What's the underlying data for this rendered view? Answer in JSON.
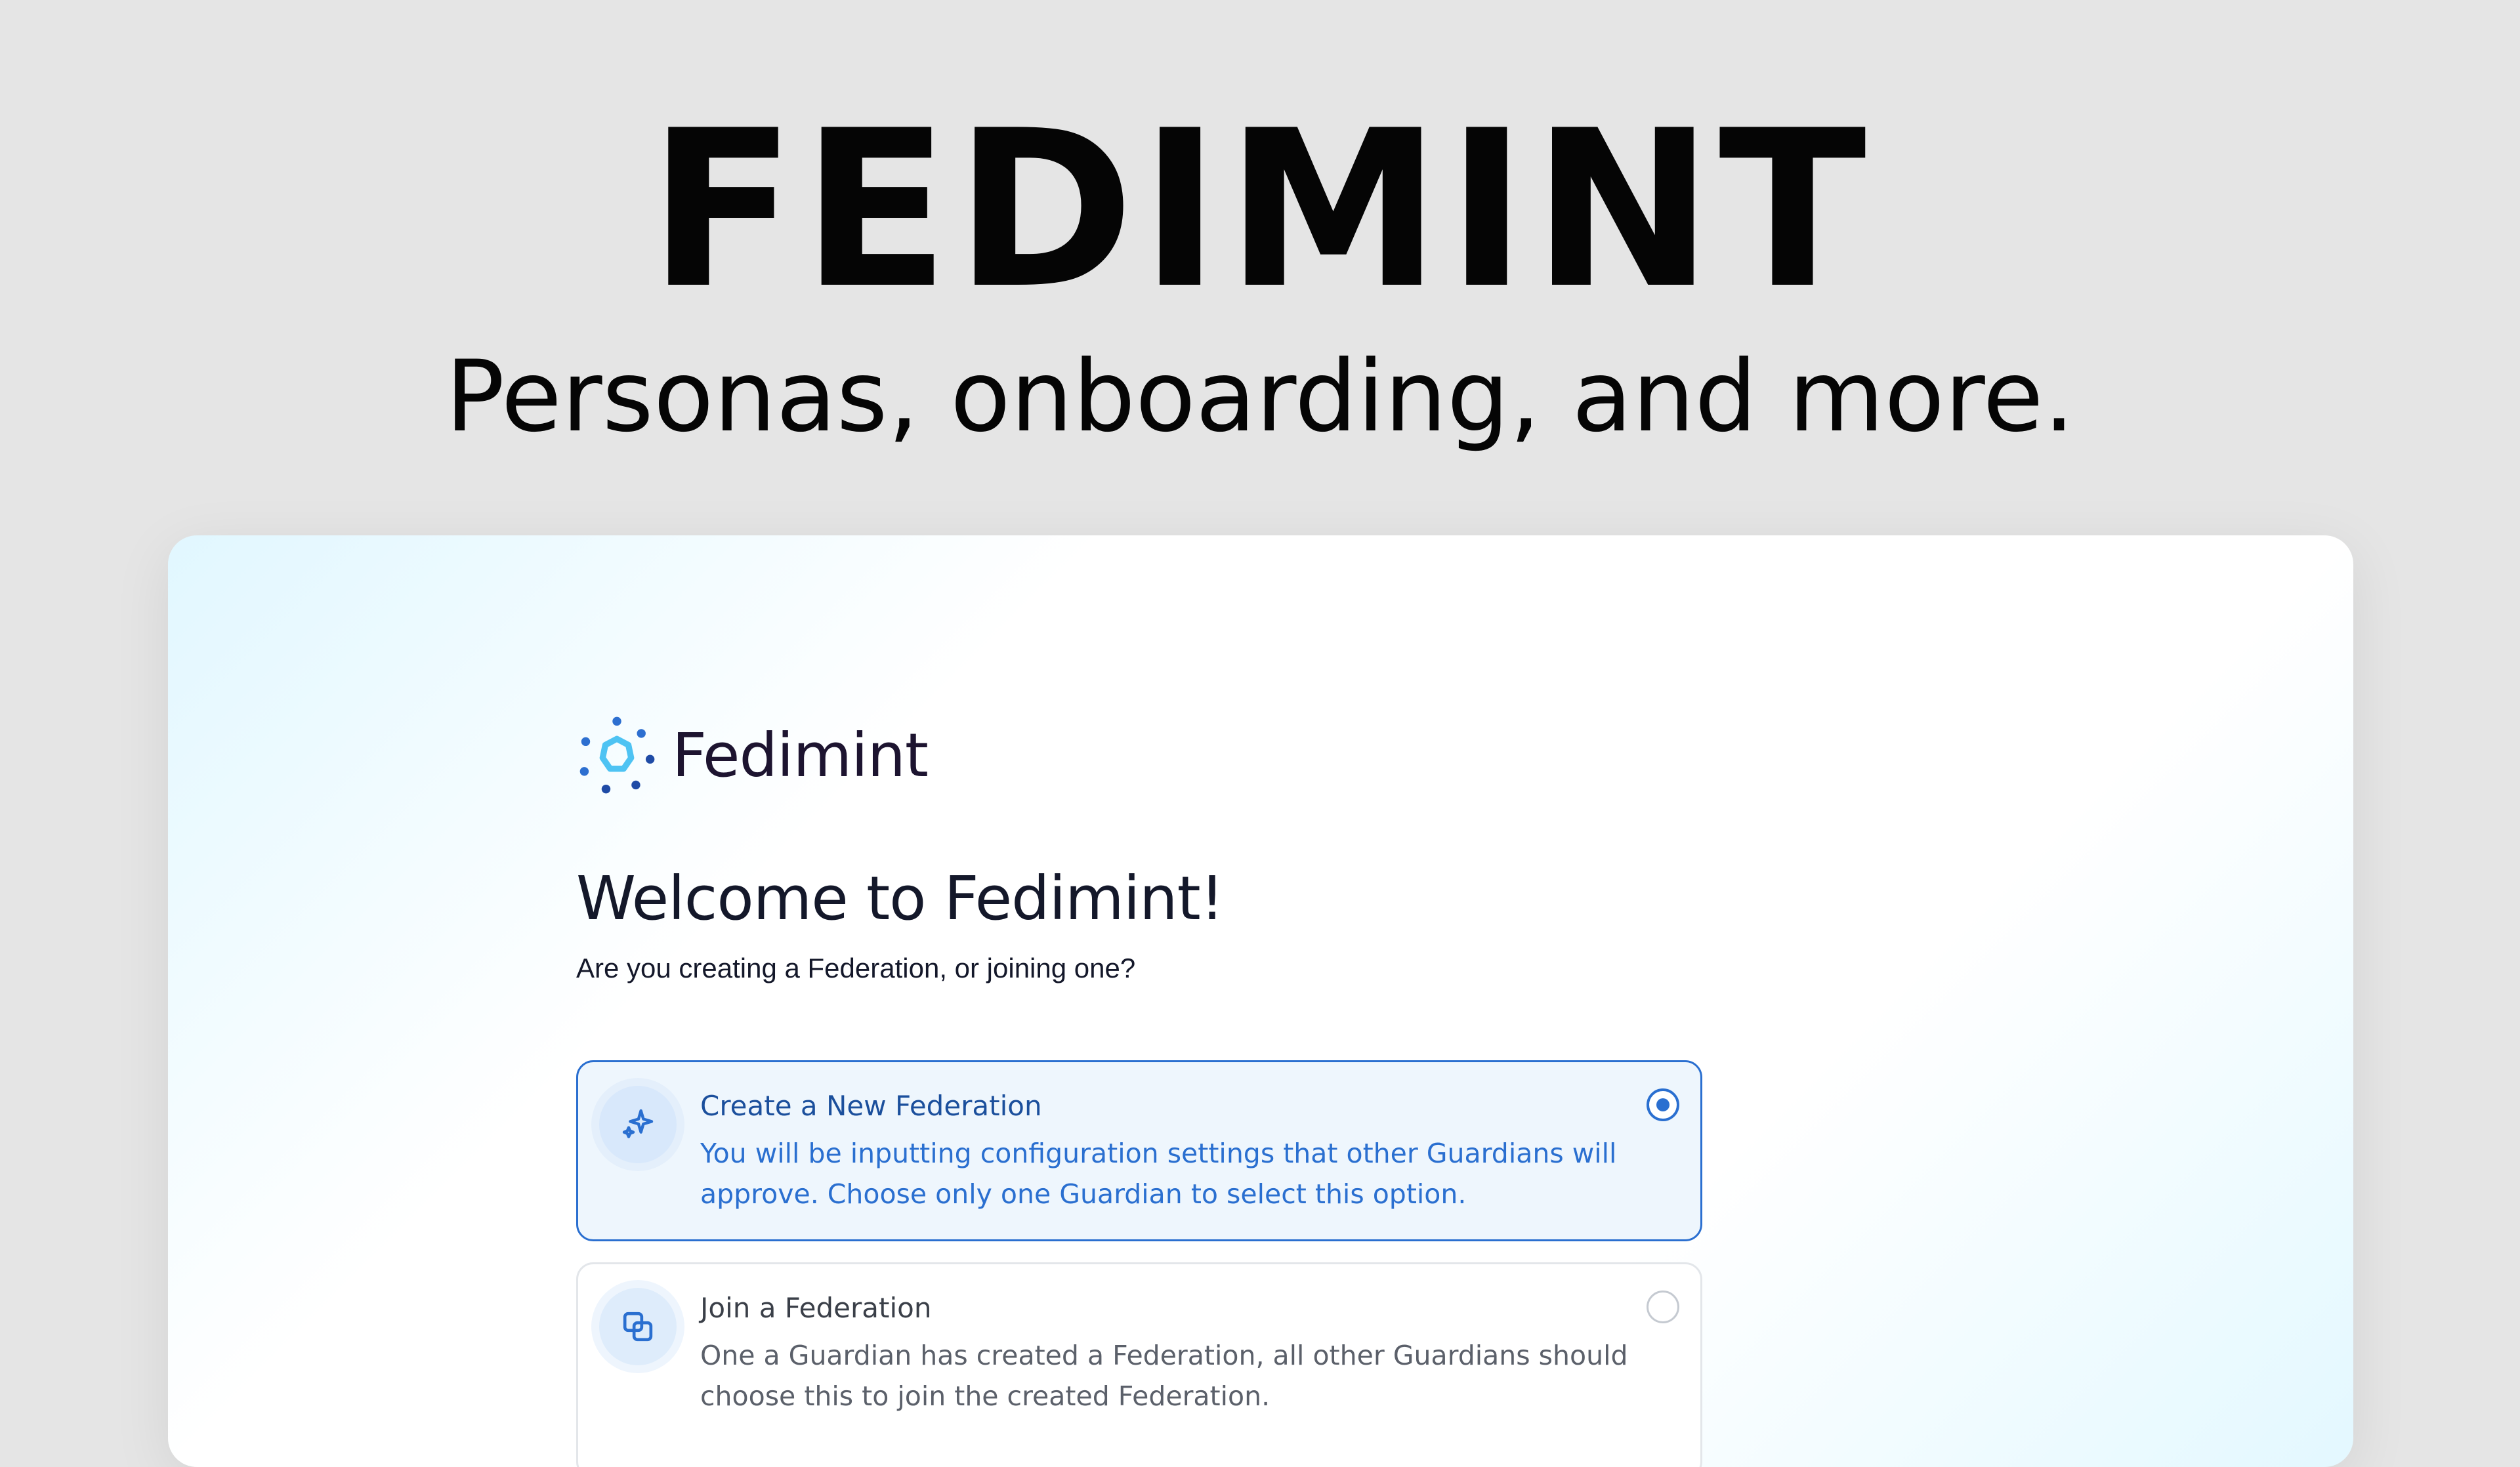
{
  "hero": {
    "title": "FEDIMINT",
    "subtitle": "Personas, onboarding, and more."
  },
  "app": {
    "brand_name": "Fedimint",
    "logo_icon": "fedimint-logo-icon",
    "heading": "Welcome to Fedimint!",
    "prompt": "Are you creating a Federation, or joining one?",
    "options": [
      {
        "title": "Create a New Federation",
        "description": "You will be inputting configuration settings that other Guardians will approve. Choose only one Guardian to select this option.",
        "icon": "sparkles-icon",
        "selected": true
      },
      {
        "title": "Join a Federation",
        "description": "One a Guardian has created a Federation, all other Guardians should choose this to join the created Federation.",
        "icon": "copy-squares-icon",
        "selected": false
      }
    ]
  },
  "colors": {
    "accent": "#2a6fd0",
    "logo_dark": "#1f4ba6",
    "logo_light": "#4ec3f3",
    "text_dark": "#14182a"
  }
}
